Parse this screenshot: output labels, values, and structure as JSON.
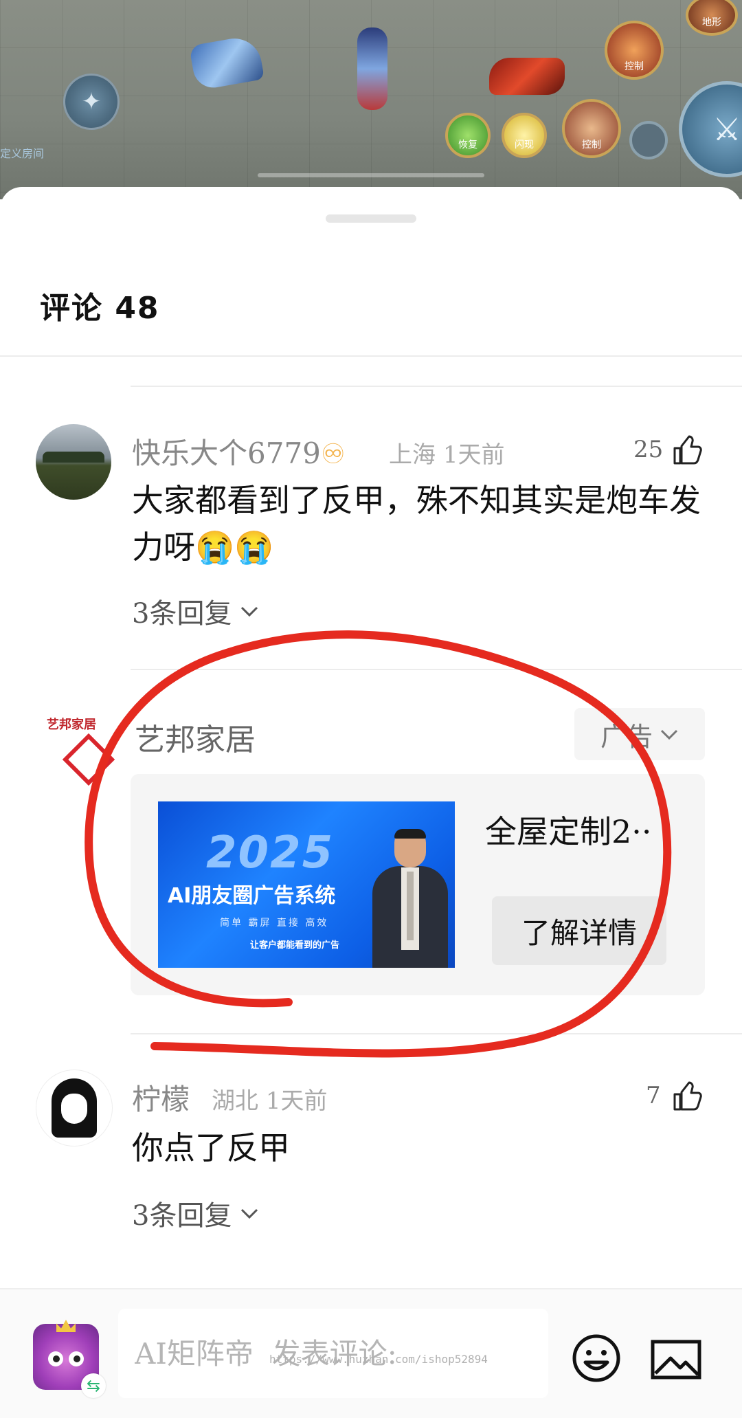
{
  "video": {
    "room_label": "定义房间",
    "skills": {
      "recover": "恢复",
      "flash": "闪现",
      "control": "控制",
      "terrain": "地形"
    }
  },
  "comments_panel": {
    "title": "评论 48"
  },
  "comments": [
    {
      "username": "快乐大个6779",
      "badge": "♾",
      "location": "上海",
      "time": "1天前",
      "likes": "25",
      "text": "大家都看到了反甲，殊不知其实是炮车发力呀😭😭",
      "replies": "3条回复"
    },
    {
      "username": "柠檬",
      "location": "湖北",
      "time": "1天前",
      "likes": "7",
      "text": "你点了反甲",
      "replies": "3条回复"
    }
  ],
  "ad": {
    "advertiser": "艺邦家居",
    "logo_text": "艺邦家居",
    "badge_label": "广告",
    "banner": {
      "year": "2025",
      "headline": "AI朋友圈广告系统",
      "sub": "简单 霸屏 直接 高效",
      "slogan": "让客户都能看到的广告"
    },
    "title": "全屋定制2··",
    "cta": "了解详情"
  },
  "input_bar": {
    "placeholder": "AI矩阵帝  发表评论:",
    "watermark": "https://www.huzhan.com/ishop52894"
  },
  "colors": {
    "annotation_red": "#e52a1f",
    "banner_blue": "#1f83ff"
  }
}
